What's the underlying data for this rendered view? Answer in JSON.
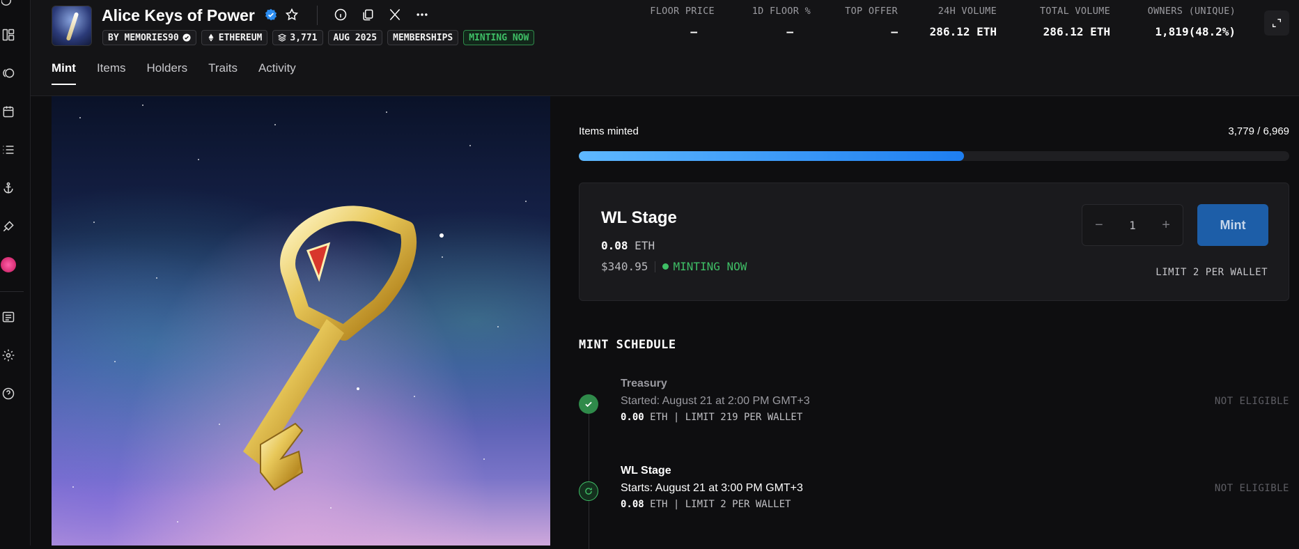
{
  "sidebar": {
    "icons": [
      "logo-icon",
      "grid-icon",
      "bubbles-icon",
      "calendar-icon",
      "list-icon",
      "anchor-icon",
      "paint-icon",
      "avatar-icon",
      "book-icon",
      "settings-icon",
      "help-icon"
    ]
  },
  "collection": {
    "title": "Alice Keys of Power",
    "creator": "BY MEMORIES90",
    "chain": "ETHEREUM",
    "items_count": "3,771",
    "date": "AUG 2025",
    "category": "MEMBERSHIPS",
    "status": "MINTING NOW"
  },
  "stats": [
    {
      "label": "FLOOR PRICE",
      "value": "–"
    },
    {
      "label": "1D FLOOR %",
      "value": "–"
    },
    {
      "label": "TOP OFFER",
      "value": "–"
    },
    {
      "label": "24H VOLUME",
      "value": "286.12 ETH"
    },
    {
      "label": "TOTAL VOLUME",
      "value": "286.12 ETH"
    },
    {
      "label": "OWNERS (UNIQUE)",
      "value": "1,819(48.2%)"
    }
  ],
  "tabs": [
    "Mint",
    "Items",
    "Holders",
    "Traits",
    "Activity"
  ],
  "mint": {
    "items_minted_label": "Items minted",
    "items_minted_value": "3,779 / 6,969",
    "progress": 0.542,
    "stage": {
      "name": "WL Stage",
      "price": "0.08",
      "currency": "ETH",
      "usd": "$340.95",
      "status": "MINTING NOW",
      "quantity": "1",
      "minus": "−",
      "plus": "+",
      "button": "Mint",
      "limit": "LIMIT 2 PER WALLET"
    }
  },
  "schedule": {
    "title": "MINT SCHEDULE",
    "items": [
      {
        "name": "Treasury",
        "when": "Started: August 21 at 2:00 PM GMT+3",
        "price": "0.00",
        "rest": " ETH | LIMIT 219 PER WALLET",
        "eligibility": "NOT ELIGIBLE"
      },
      {
        "name": "WL Stage",
        "when": "Starts: August 21 at 3:00 PM GMT+3",
        "price": "0.08",
        "rest": " ETH | LIMIT 2 PER WALLET",
        "eligibility": "NOT ELIGIBLE"
      }
    ]
  },
  "colors": {
    "accent": "#1e7ef0",
    "green": "#3fbf66",
    "background": "#0e0e10"
  }
}
